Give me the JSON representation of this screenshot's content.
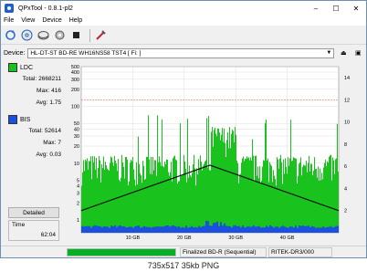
{
  "window": {
    "title": "QPxTool - 0.8.1-pl2"
  },
  "menu": [
    "File",
    "View",
    "Device",
    "Help"
  ],
  "toolbar": {
    "icons": [
      "refresh-icon",
      "disc-icon",
      "scan-icon",
      "settings-icon",
      "stop-icon",
      "tools-icon"
    ]
  },
  "device": {
    "label": "Device:",
    "selected": "HL-DT-ST BD-RE  WH16NS58  TST4 [ Fi: ]"
  },
  "legend": {
    "ldc": {
      "name": "LDC",
      "color": "#19c21c",
      "total_label": "Total:",
      "total": "2668211",
      "max_label": "Max:",
      "max": "416",
      "avg_label": "Avg:",
      "avg": "1.75"
    },
    "bis": {
      "name": "BIS",
      "color": "#1a4fe0",
      "total_label": "Total:",
      "total": "52614",
      "max_label": "Max:",
      "max": "7",
      "avg_label": "Avg:",
      "avg": "0.03"
    }
  },
  "detailed_label": "Detailed",
  "time": {
    "label": "Time",
    "value": "62:04"
  },
  "status": {
    "progress": 1.0,
    "media": "Finalized BD-R (Sequential)",
    "mid": "RITEK-DR3/000"
  },
  "caption": "735x517  35kb  PNG",
  "chart_data": {
    "type": "bar",
    "x_ticks": [
      "10 GB",
      "20 GB",
      "30 GB",
      "40 GB"
    ],
    "x_range_gb": [
      0,
      50
    ],
    "y_left_ticks": [
      "500",
      "400",
      "300",
      "200",
      "100",
      "50",
      "40",
      "30",
      "20",
      "10",
      "5",
      "4",
      "3",
      "2",
      "1"
    ],
    "y_right_ticks": [
      "14",
      "12",
      "10",
      "8",
      "6",
      "4",
      "2"
    ],
    "y_scale": "log",
    "series": [
      {
        "name": "LDC",
        "color": "#19c21c"
      },
      {
        "name": "BIS",
        "color": "#1a4fe0"
      }
    ],
    "speed_line": [
      {
        "x": 0,
        "y": 2.0
      },
      {
        "x": 25,
        "y": 6.1
      },
      {
        "x": 50,
        "y": 2.0
      }
    ],
    "limit_line_right": 12
  }
}
